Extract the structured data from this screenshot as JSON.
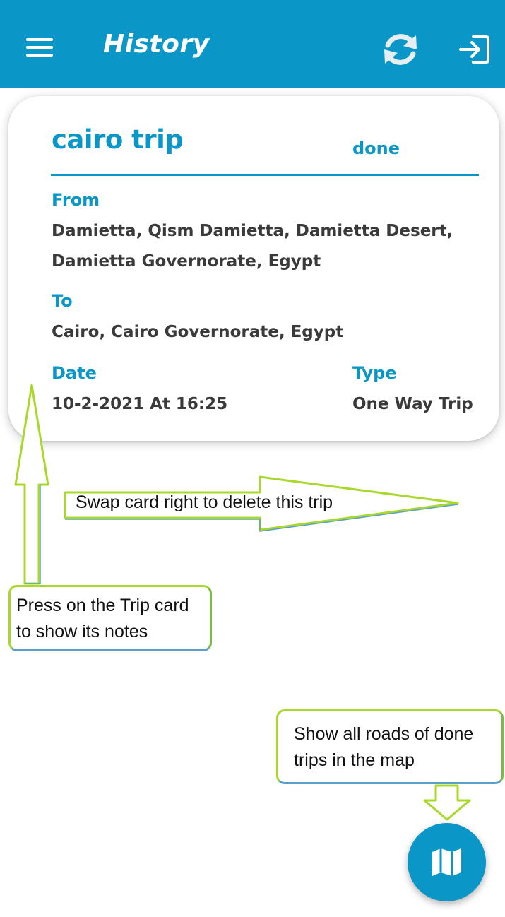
{
  "app_bar": {
    "title": "History",
    "menu_icon": "hamburger-menu-icon",
    "refresh_icon": "refresh-icon",
    "logout_icon": "logout-icon",
    "background": "#0a97c8"
  },
  "trip_card": {
    "name": "cairo trip",
    "status": "done",
    "from_label": "From",
    "from_value_line1": "Damietta, Qism Damietta, Damietta Desert,",
    "from_value_line2": "Damietta Governorate, Egypt",
    "to_label": "To",
    "to_value": "Cairo, Cairo Governorate, Egypt",
    "date_label": "Date",
    "date_value": "10-2-2021 At 16:25",
    "type_label": "Type",
    "type_value": "One Way Trip"
  },
  "annotations": {
    "swipe_hint": "Swap card right to delete this trip",
    "press_hint_line1": "Press on the Trip card",
    "press_hint_line2": "to show its notes",
    "map_hint_line1": "Show all roads of done",
    "map_hint_line2": "trips in the map",
    "highlight_color": "#a8d92a"
  },
  "fab": {
    "icon": "map-icon"
  }
}
